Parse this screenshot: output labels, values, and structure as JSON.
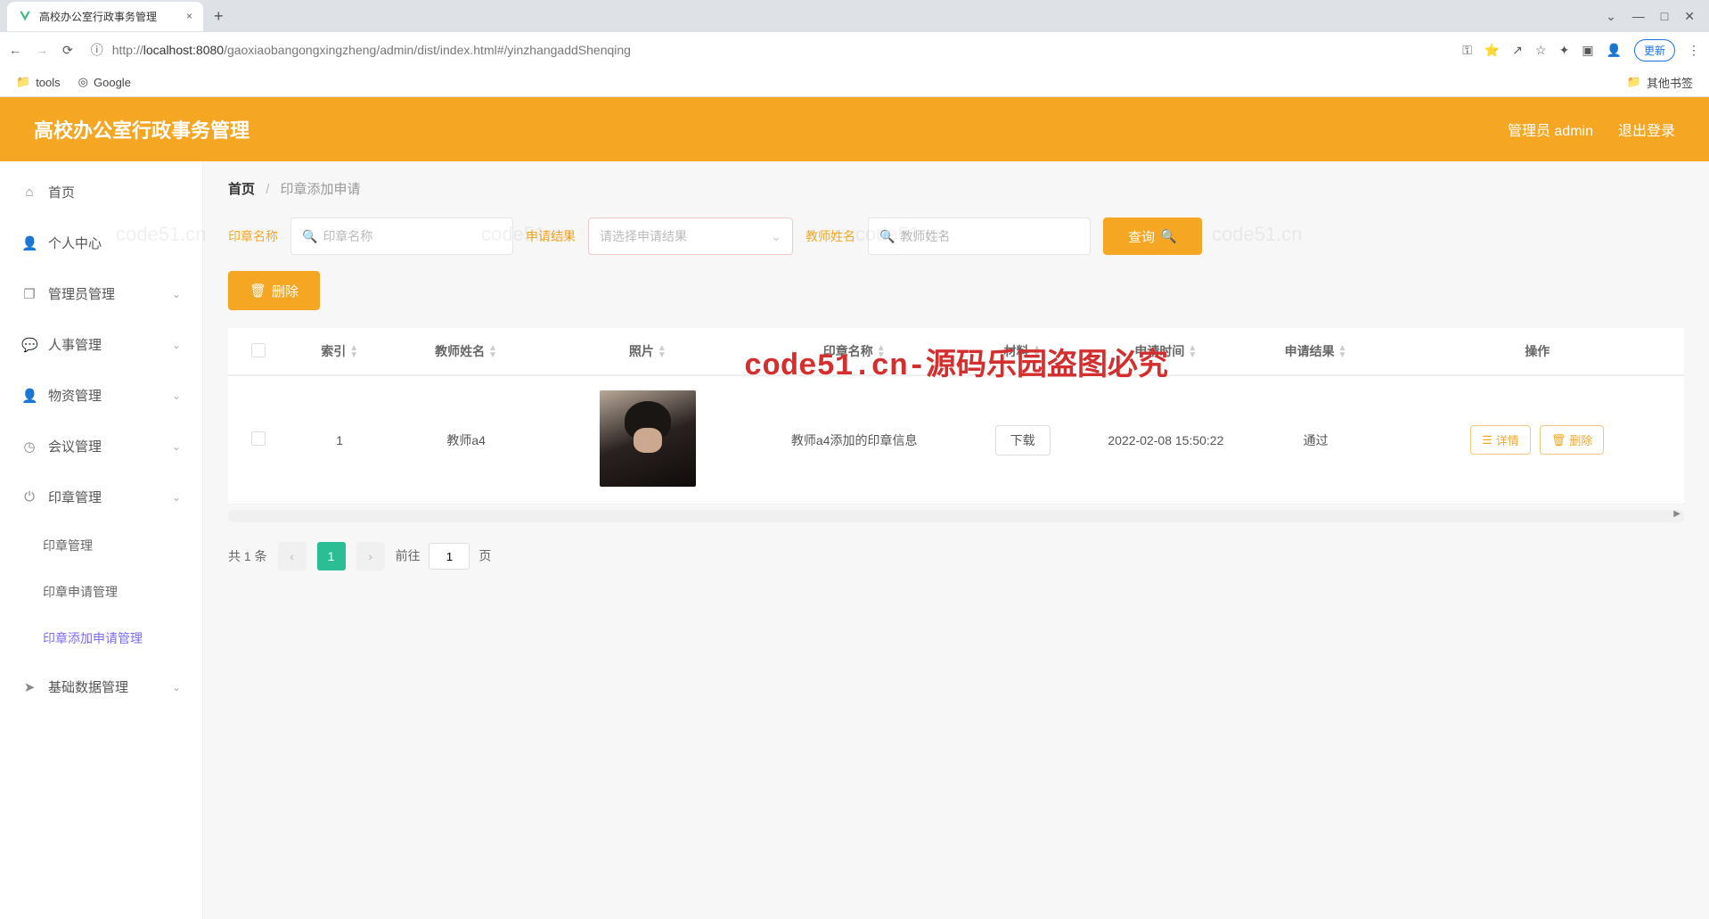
{
  "browser": {
    "tab_title": "高校办公室行政事务管理",
    "url_host": "localhost:8080",
    "url_path": "/gaoxiaobangongxingzheng/admin/dist/index.html#/yinzhangaddShenqing",
    "url_prefix": "http://",
    "update_label": "更新",
    "bookmarks": {
      "tools": "tools",
      "google": "Google",
      "other": "其他书签"
    }
  },
  "header": {
    "title": "高校办公室行政事务管理",
    "user_label": "管理员 admin",
    "logout": "退出登录"
  },
  "sidebar": {
    "items": [
      {
        "icon": "home",
        "label": "首页"
      },
      {
        "icon": "user",
        "label": "个人中心"
      },
      {
        "icon": "copy",
        "label": "管理员管理",
        "expandable": true
      },
      {
        "icon": "msg",
        "label": "人事管理",
        "expandable": true
      },
      {
        "icon": "user",
        "label": "物资管理",
        "expandable": true
      },
      {
        "icon": "globe",
        "label": "会议管理",
        "expandable": true
      },
      {
        "icon": "power",
        "label": "印章管理",
        "expandable": true,
        "expanded": true,
        "children": [
          {
            "label": "印章管理"
          },
          {
            "label": "印章申请管理"
          },
          {
            "label": "印章添加申请管理",
            "active": true
          }
        ]
      },
      {
        "icon": "send",
        "label": "基础数据管理",
        "expandable": true
      }
    ]
  },
  "breadcrumb": {
    "home": "首页",
    "current": "印章添加申请"
  },
  "search": {
    "name_label": "印章名称",
    "name_placeholder": "印章名称",
    "result_label": "申请结果",
    "result_placeholder": "请选择申请结果",
    "teacher_label": "教师姓名",
    "teacher_placeholder": "教师姓名",
    "query_label": "查询"
  },
  "toolbar": {
    "delete_label": "删除"
  },
  "watermark": "code51.cn-源码乐园盗图必究",
  "table": {
    "headers": {
      "index": "索引",
      "teacher": "教师姓名",
      "photo": "照片",
      "seal_name": "印章名称",
      "material": "材料",
      "apply_time": "申请时间",
      "apply_result": "申请结果",
      "actions": "操作"
    },
    "rows": [
      {
        "index": "1",
        "teacher": "教师a4",
        "seal_name": "教师a4添加的印章信息",
        "material_btn": "下载",
        "apply_time": "2022-02-08 15:50:22",
        "apply_result": "通过",
        "detail_btn": "详情",
        "delete_btn": "删除"
      }
    ]
  },
  "pagination": {
    "total_text": "共 1 条",
    "current_page": "1",
    "jump_prefix": "前往",
    "jump_suffix": "页",
    "jump_value": "1"
  }
}
